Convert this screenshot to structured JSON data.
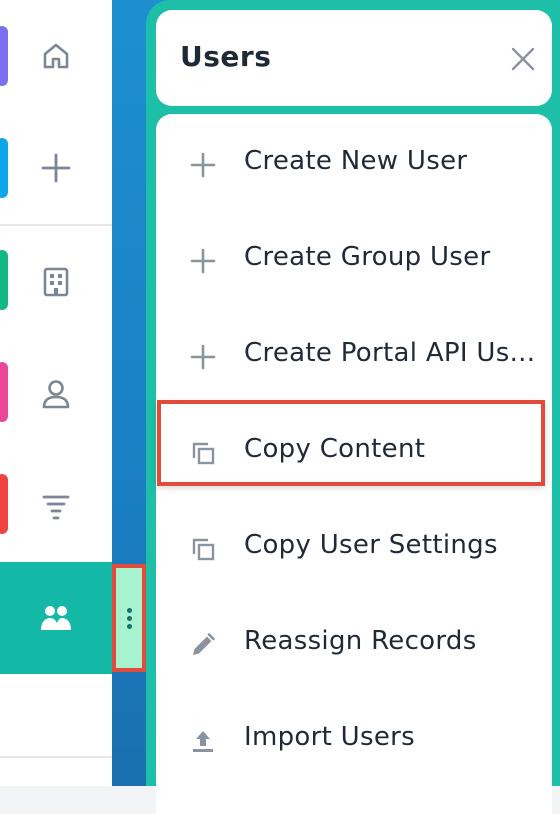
{
  "rail": {
    "items": [
      {
        "name": "home",
        "accent": "#7c6ff2"
      },
      {
        "name": "create",
        "accent": "#0ea5e9"
      },
      {
        "name": "accounts",
        "accent": "#10b981"
      },
      {
        "name": "contacts",
        "accent": "#ec4899"
      },
      {
        "name": "filter",
        "accent": "#ef4444"
      },
      {
        "name": "users",
        "active": true
      }
    ]
  },
  "panel": {
    "title": "Users",
    "menu": [
      {
        "label": "Create New User",
        "icon": "plus-icon"
      },
      {
        "label": "Create Group User",
        "icon": "plus-icon"
      },
      {
        "label": "Create Portal API Us...",
        "icon": "plus-icon"
      },
      {
        "label": "Copy Content",
        "icon": "copy-icon",
        "highlighted": true
      },
      {
        "label": "Copy User Settings",
        "icon": "copy-icon"
      },
      {
        "label": "Reassign Records",
        "icon": "pencil-icon"
      },
      {
        "label": "Import Users",
        "icon": "upload-icon"
      }
    ]
  },
  "colors": {
    "panel": "#1dbfa9",
    "active_rail": "#14b8a6",
    "highlight": "#e04b3a"
  }
}
